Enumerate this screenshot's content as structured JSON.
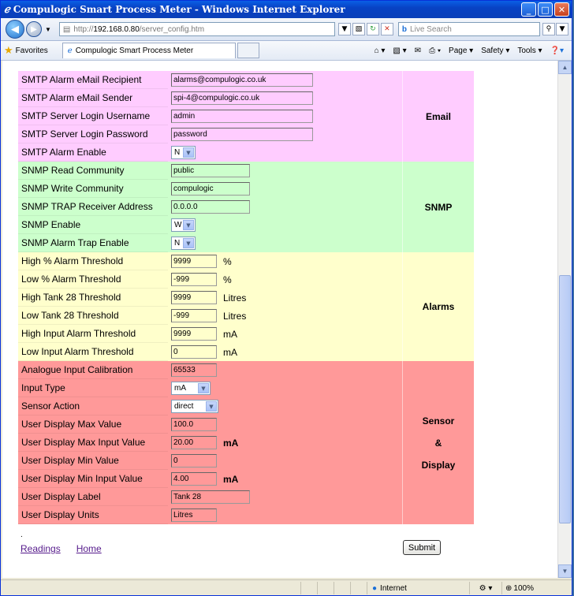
{
  "window": {
    "title": "Compulogic Smart Process Meter - Windows Internet Explorer"
  },
  "address": {
    "prefix": "http://",
    "host": "192.168.0.80",
    "path": "/server_config.htm"
  },
  "search": {
    "brand": "Live Search",
    "placeholder": ""
  },
  "favorites": {
    "label": "Favorites",
    "tab_title": "Compulogic Smart Process Meter"
  },
  "commands": {
    "page": "Page ▾",
    "safety": "Safety ▾",
    "tools": "Tools ▾"
  },
  "email": {
    "group": "Email",
    "rows": [
      {
        "label": "SMTP Alarm eMail Recipient",
        "value": "alarms@compulogic.co.uk"
      },
      {
        "label": "SMTP Alarm eMail Sender",
        "value": "spi-4@compulogic.co.uk"
      },
      {
        "label": "SMTP Server Login Username",
        "value": "admin"
      },
      {
        "label": "SMTP Server Login Password",
        "value": "password"
      },
      {
        "label": "SMTP Alarm  Enable",
        "value": "N"
      }
    ]
  },
  "snmp": {
    "group": "SNMP",
    "rows": [
      {
        "label": "SNMP Read Community",
        "value": "public"
      },
      {
        "label": "SNMP Write Community",
        "value": "compulogic"
      },
      {
        "label": "SNMP TRAP Receiver Address",
        "value": "0.0.0.0"
      },
      {
        "label": "SNMP Enable",
        "value": "W"
      },
      {
        "label": "SNMP Alarm Trap Enable",
        "value": "N"
      }
    ]
  },
  "alarms": {
    "group": "Alarms",
    "rows": [
      {
        "label": "High % Alarm Threshold",
        "value": "9999",
        "unit": "%"
      },
      {
        "label": "Low % Alarm Threshold",
        "value": "-999",
        "unit": "%"
      },
      {
        "label": "High Tank 28 Threshold",
        "value": "9999",
        "unit": "Litres"
      },
      {
        "label": "Low Tank 28 Threshold",
        "value": "-999",
        "unit": "Litres"
      },
      {
        "label": "High Input Alarm Threshold",
        "value": "9999",
        "unit": "mA"
      },
      {
        "label": "Low Input Alarm Threshold",
        "value": "0",
        "unit": "mA"
      }
    ]
  },
  "sensor": {
    "group1": "Sensor",
    "group2": "&",
    "group3": "Display",
    "rows": [
      {
        "label": "Analogue Input Calibration",
        "value": "65533"
      },
      {
        "label": "Input Type",
        "value": "mA"
      },
      {
        "label": "Sensor Action",
        "value": "direct"
      },
      {
        "label": "User Display Max Value",
        "value": "100.0"
      },
      {
        "label": "User Display Max Input Value",
        "value": "20.00",
        "unit": "mA"
      },
      {
        "label": "User Display Min Value",
        "value": "0"
      },
      {
        "label": "User Display Min Input Value",
        "value": "4.00",
        "unit": "mA"
      },
      {
        "label": "User Display Label",
        "value": "Tank 28"
      },
      {
        "label": "User Display Units",
        "value": "Litres"
      }
    ]
  },
  "footer": {
    "dot": ".",
    "readings": "Readings",
    "home": "Home",
    "submit": "Submit"
  },
  "status": {
    "zone": "Internet",
    "zoom": "100%"
  }
}
